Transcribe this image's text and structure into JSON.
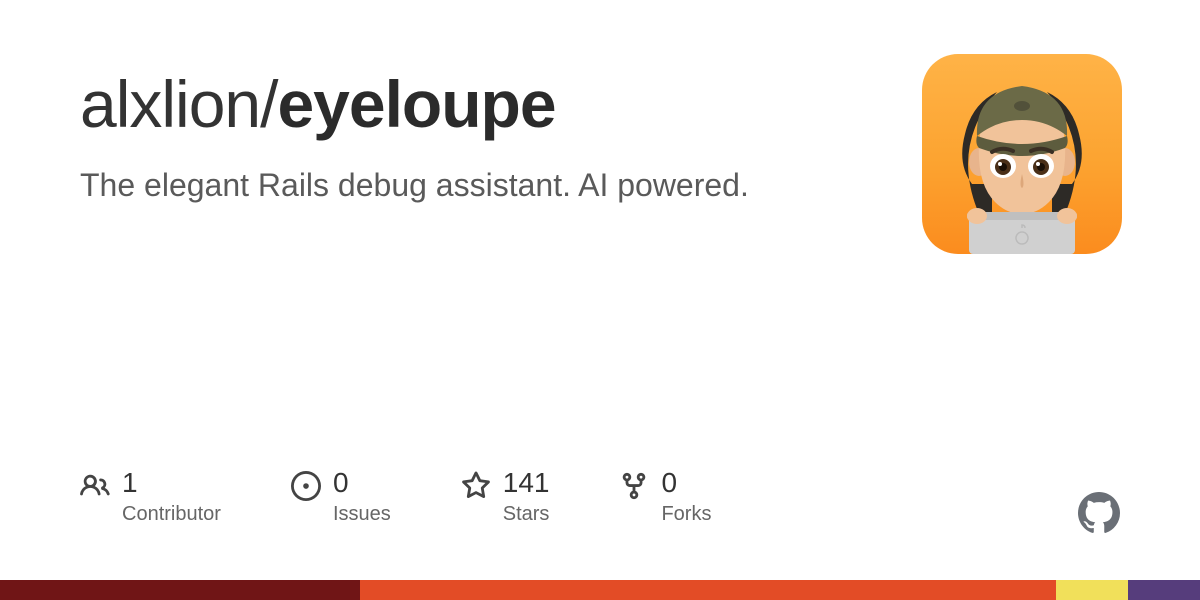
{
  "owner": "alxlion",
  "separator": "/",
  "repo": "eyeloupe",
  "description": "The elegant Rails debug assistant. AI powered.",
  "stats": [
    {
      "icon": "people-icon",
      "count": "1",
      "label": "Contributor"
    },
    {
      "icon": "issues-icon",
      "count": "0",
      "label": "Issues"
    },
    {
      "icon": "star-icon",
      "count": "141",
      "label": "Stars"
    },
    {
      "icon": "fork-icon",
      "count": "0",
      "label": "Forks"
    }
  ],
  "language_bar": [
    {
      "color": "#701516",
      "pct": 30
    },
    {
      "color": "#e34c26",
      "pct": 58
    },
    {
      "color": "#f1e05a",
      "pct": 6
    },
    {
      "color": "#563d7c",
      "pct": 6
    }
  ]
}
